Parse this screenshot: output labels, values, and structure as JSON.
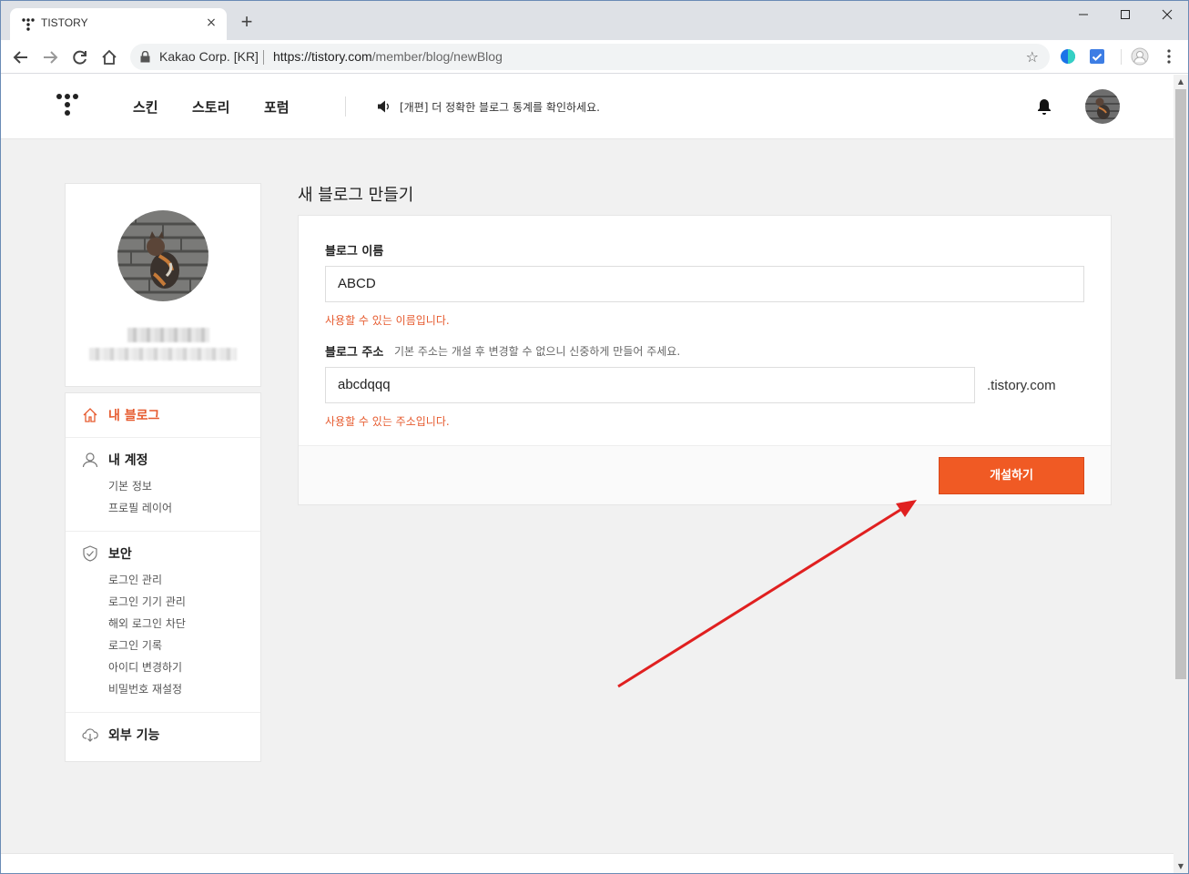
{
  "browser": {
    "tab_title": "TISTORY",
    "tab_close": "×",
    "new_tab": "+",
    "origin": "Kakao Corp. [KR]",
    "url_host": "https://tistory.com",
    "url_path": "/member/blog/newBlog"
  },
  "header": {
    "nav": [
      "스킨",
      "스토리",
      "포럼"
    ],
    "notice": "[개편] 더 정확한 블로그 통계를 확인하세요."
  },
  "sidebar": {
    "groups": [
      {
        "label": "내 블로그",
        "icon": "home-icon",
        "active": true,
        "items": []
      },
      {
        "label": "내 계정",
        "icon": "user-icon",
        "active": false,
        "items": [
          "기본 정보",
          "프로필 레이어"
        ]
      },
      {
        "label": "보안",
        "icon": "shield-icon",
        "active": false,
        "items": [
          "로그인 관리",
          "로그인 기기 관리",
          "해외 로그인 차단",
          "로그인 기록",
          "아이디 변경하기",
          "비밀번호 재설정"
        ]
      },
      {
        "label": "외부 기능",
        "icon": "cloud-download-icon",
        "active": false,
        "items": []
      }
    ]
  },
  "form": {
    "title": "새 블로그 만들기",
    "name_label": "블로그 이름",
    "name_value": "ABCD",
    "name_message": "사용할 수 있는 이름입니다.",
    "address_label": "블로그 주소",
    "address_hint": "기본 주소는 개설 후 변경할 수 없으니 신중하게 만들어 주세요.",
    "address_value": "abcdqqq",
    "address_suffix": ".tistory.com",
    "address_message": "사용할 수 있는 주소입니다.",
    "submit_label": "개설하기"
  },
  "colors": {
    "accent": "#f05a24",
    "arrow": "#e02020"
  }
}
